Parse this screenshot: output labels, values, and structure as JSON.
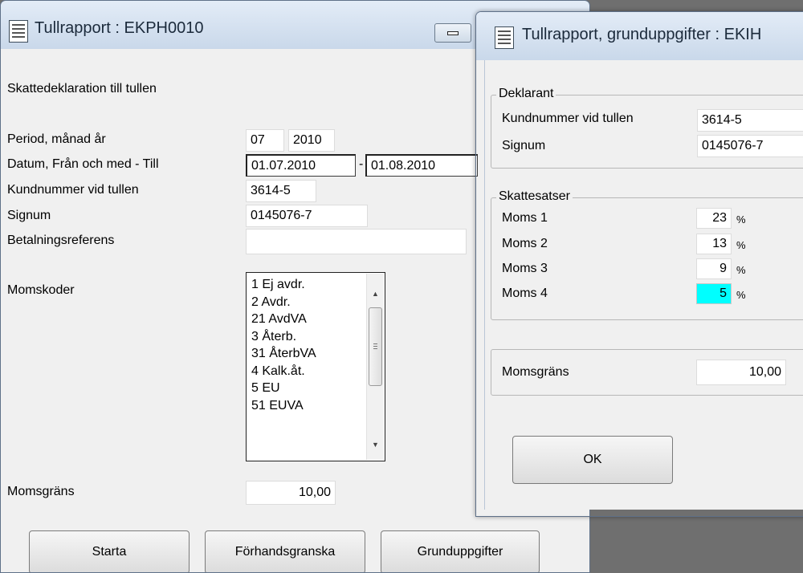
{
  "main_window": {
    "title": "Tullrapport : EKPH0010",
    "heading": "Skattedeklaration till tullen",
    "period_label": "Period, månad år",
    "period_month": "07",
    "period_year": "2010",
    "datum_label": "Datum, Från och med - Till",
    "datum_from": "01.07.2010",
    "datum_separator": "-",
    "datum_to": "01.08.2010",
    "kundnummer_label": "Kundnummer vid tullen",
    "kundnummer_value": "3614-5",
    "signum_label": "Signum",
    "signum_value": "0145076-7",
    "betalningsreferens_label": "Betalningsreferens",
    "betalningsreferens_value": "",
    "momskoder_label": "Momskoder",
    "momskoder_items": [
      "1 Ej avdr.",
      "2 Avdr.",
      "21 AvdVA",
      "3 Återb.",
      "31 ÅterbVA",
      "4 Kalk.åt.",
      "5 EU",
      "51 EUVA"
    ],
    "momsgrans_label": "Momsgräns",
    "momsgrans_value": "10,00",
    "buttons": {
      "starta": "Starta",
      "forhandsgranska": "Förhandsgranska",
      "grunduppgifter": "Grunduppgifter"
    }
  },
  "dialog": {
    "title": "Tullrapport, grunduppgifter : EKIH",
    "deklarant_group": "Deklarant",
    "kundnummer_label": "Kundnummer vid tullen",
    "kundnummer_value": "3614-5",
    "signum_label": "Signum",
    "signum_value": "0145076-7",
    "skattesatser_group": "Skattesatser",
    "moms": [
      {
        "label": "Moms 1",
        "value": "23",
        "unit": "%"
      },
      {
        "label": "Moms 2",
        "value": "13",
        "unit": "%"
      },
      {
        "label": "Moms 3",
        "value": "9",
        "unit": "%"
      },
      {
        "label": "Moms 4",
        "value": "5",
        "unit": "%"
      }
    ],
    "momsgrans_label": "Momsgräns",
    "momsgrans_value": "10,00",
    "ok_button": "OK"
  },
  "colors": {
    "selected_field": "#00ffff",
    "titlebar": "#c9d8ea",
    "background": "#6f6f6f"
  },
  "icons": {
    "window_icon": "document-icon",
    "minimize": "minimize-icon"
  }
}
